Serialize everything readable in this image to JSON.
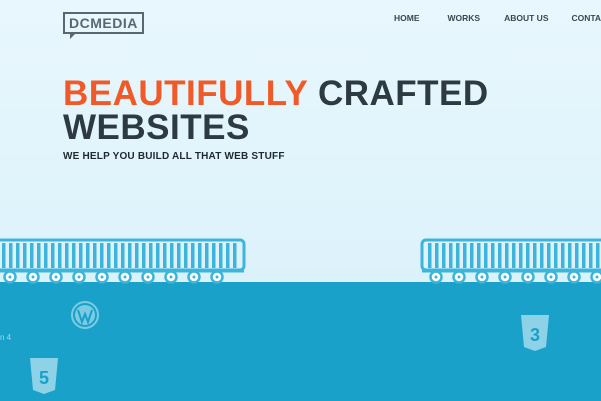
{
  "brand": {
    "logo_text": "DCMEDIA"
  },
  "nav": {
    "items": [
      {
        "label": "HOME"
      },
      {
        "label": "WORKS"
      },
      {
        "label": "ABOUT US"
      },
      {
        "label": "CONTACTS"
      }
    ]
  },
  "hero": {
    "headline_accent": "BEAUTIFULLY",
    "headline_rest": "CRAFTED",
    "headline_line2": "WEBSITES",
    "tagline": "WE HELP YOU BUILD ALL THAT WEB STUFF"
  },
  "water": {
    "cut_text": "n 4",
    "icons": [
      "wordpress-icon",
      "html5-icon",
      "css3-icon"
    ],
    "icon_labels": {
      "html5": "5",
      "css3": "3"
    }
  },
  "colors": {
    "accent": "#f05a28",
    "heading": "#2d3a42",
    "sky": "#dff3fb",
    "water": "#1aa1c9",
    "train": "#3cb4dc"
  }
}
